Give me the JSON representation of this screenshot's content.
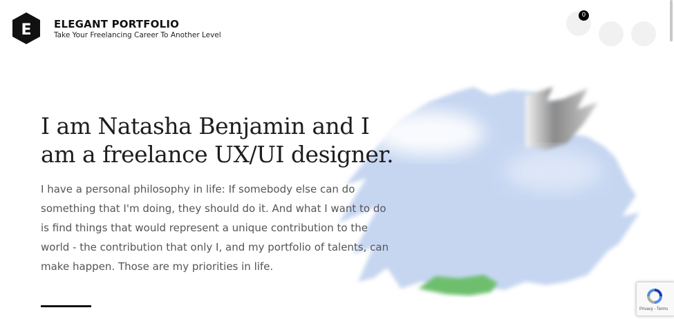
{
  "header": {
    "logo_letter": "E",
    "brand_name": "ELEGANT PORTFOLIO",
    "tagline": "Take Your Freelancing Career To Another Level",
    "cart_count": "0"
  },
  "hero": {
    "title": "I am Natasha Benjamin and I am a freelance UX/UI designer.",
    "description": "I have a personal philosophy in life: If somebody else can do something that I'm doing, they should do it. And what I want to do is find things that would represent a unique contribution to the world - the contribution that only I, and my portfolio of talents, can make happen. Those are my priorities in life."
  },
  "recaptcha": {
    "privacy": "Privacy",
    "separator": " - ",
    "terms": "Terms"
  },
  "colors": {
    "logo_bg": "#111111",
    "title": "#1e1e1e",
    "body_text": "#555555",
    "paint_blue": "#c3d4f0",
    "paint_green": "#6dbf6d"
  },
  "icons": [
    "logo-hexagon",
    "cart-icon",
    "recaptcha-icon"
  ]
}
